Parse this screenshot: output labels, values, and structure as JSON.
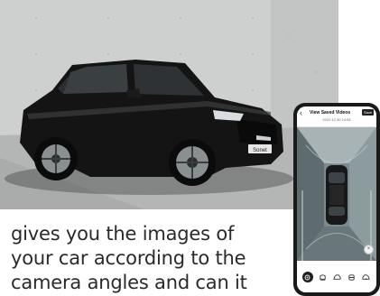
{
  "caption": {
    "line1": "gives you the images of",
    "line2": "your car according to the",
    "line3": "camera angles and can it"
  },
  "photo": {
    "badge_text": "Sonet",
    "car_color": "#141414",
    "wall_color": "#c9cccb"
  },
  "app": {
    "title": "View Saved Videos",
    "save_label": "Save",
    "timestamp": "2022.12.30 14:54",
    "back_icon": "chevron-left-icon",
    "close_icon": "close-icon",
    "toolbar_icons": [
      "camera-icon",
      "seat-icon",
      "car-front-icon",
      "car-side-icon",
      "car-rear-icon"
    ]
  }
}
